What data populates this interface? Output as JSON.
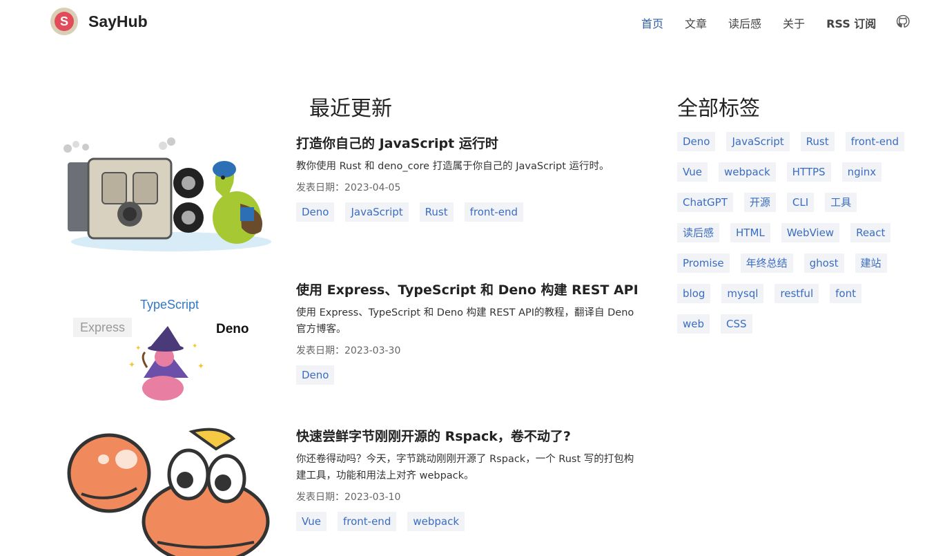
{
  "brand": {
    "name": "SayHub",
    "logo_letter": "S"
  },
  "nav": {
    "items": [
      "首页",
      "文章",
      "读后感",
      "关于",
      "RSS 订阅"
    ],
    "active": "首页",
    "github_icon": "github-icon"
  },
  "recent": {
    "title": "最近更新",
    "posts": [
      {
        "title": "打造你自己的 JavaScript 运行时",
        "desc": "教你使用 Rust 和 deno_core 打造属于你自己的 JavaScript 运行时。",
        "date": "发表日期：2023-04-05",
        "tags": [
          "Deno",
          "JavaScript",
          "Rust",
          "front-end"
        ]
      },
      {
        "title": "使用 Express、TypeScript 和 Deno 构建 REST API",
        "desc": "使用 Express、TypeScript 和 Deno 构建 REST API的教程，翻译自 Deno 官方博客。",
        "date": "发表日期：2023-03-30",
        "tags": [
          "Deno"
        ],
        "thumb_labels": {
          "typescript": "TypeScript",
          "express": "Express",
          "deno": "Deno"
        }
      },
      {
        "title": "快速尝鲜字节刚刚开源的 Rspack，卷不动了?",
        "desc": "你还卷得动吗？今天，字节跳动刚刚开源了 Rspack，一个 Rust 写的打包构建工具，功能和用法上对齐 webpack。",
        "date": "发表日期：2023-03-10",
        "tags": [
          "Vue",
          "front-end",
          "webpack"
        ]
      }
    ]
  },
  "tags_panel": {
    "title": "全部标签",
    "tags": [
      "Deno",
      "JavaScript",
      "Rust",
      "front-end",
      "Vue",
      "webpack",
      "HTTPS",
      "nginx",
      "ChatGPT",
      "开源",
      "CLI",
      "工具",
      "读后感",
      "HTML",
      "WebView",
      "React",
      "Promise",
      "年终总结",
      "ghost",
      "建站",
      "blog",
      "mysql",
      "restful",
      "font",
      "web",
      "CSS"
    ]
  },
  "colors": {
    "accent": "#3a6cc2",
    "tag_bg": "#f1f3f6",
    "nav_active": "#2f5fa3"
  }
}
